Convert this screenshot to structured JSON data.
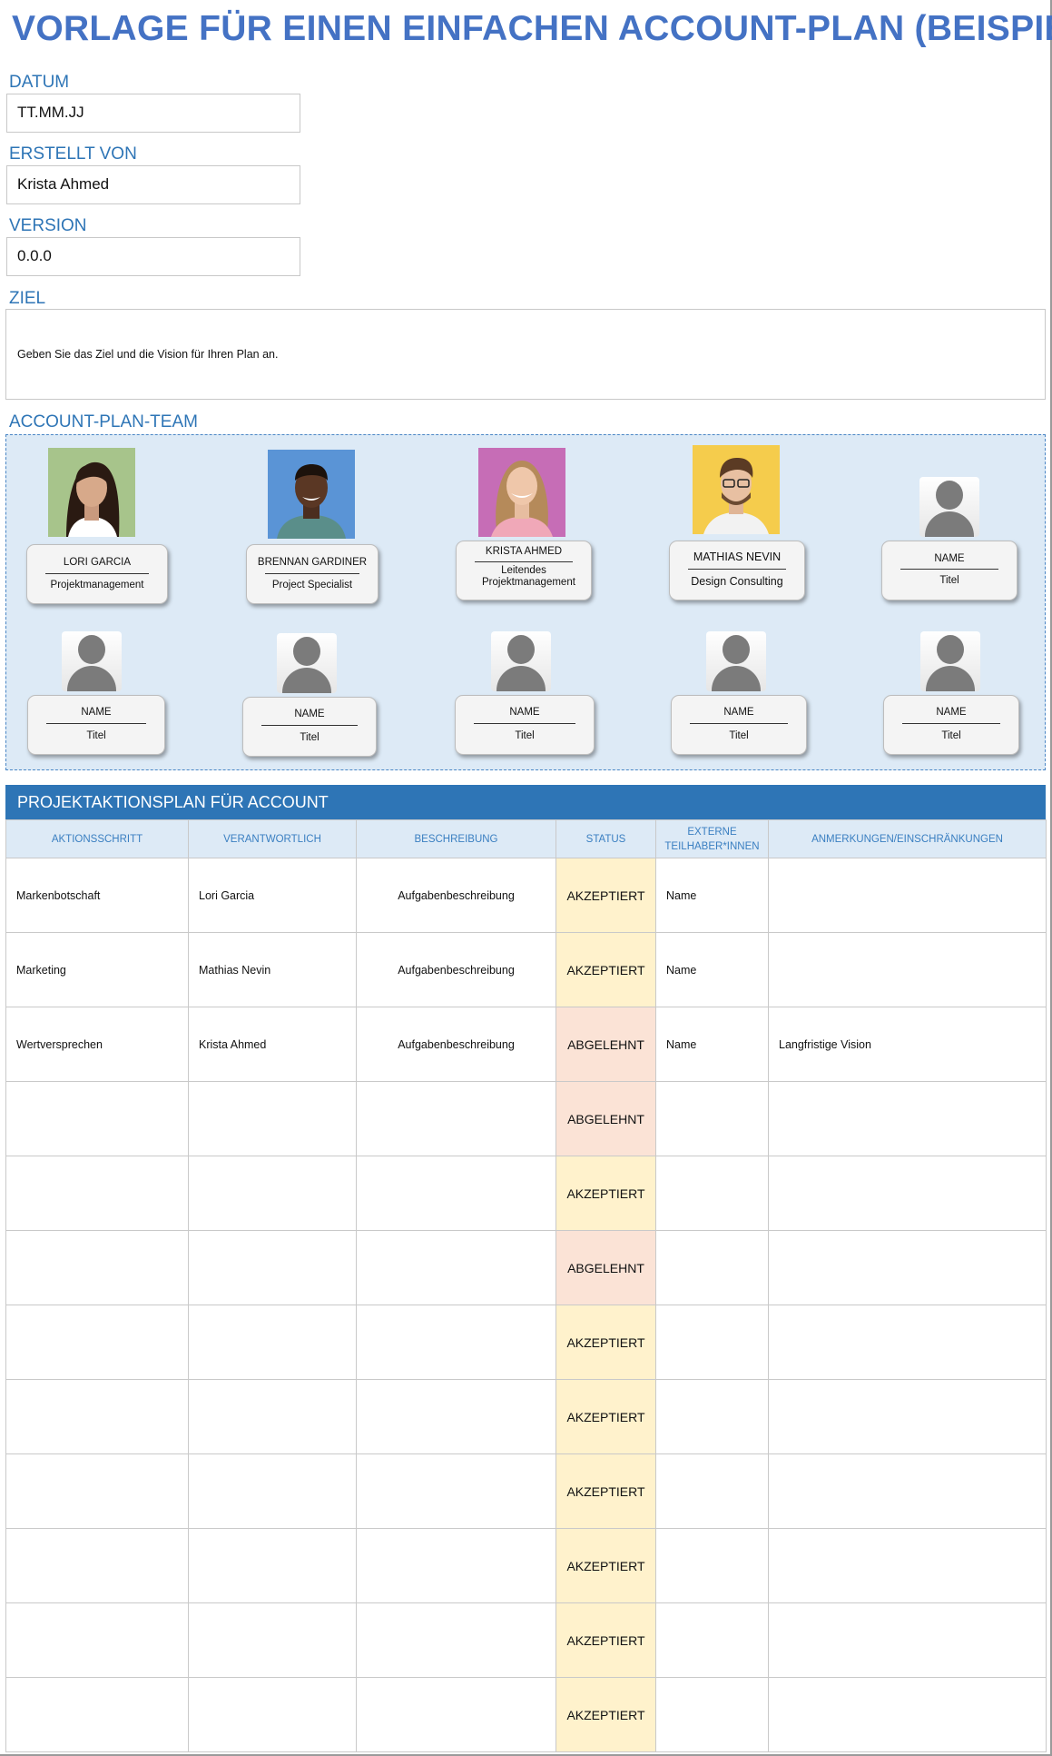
{
  "title": "VORLAGE FÜR EINEN EINFACHEN ACCOUNT-PLAN (BEISPIEL)",
  "fields": {
    "datum_label": "DATUM",
    "datum_value": "TT.MM.JJ",
    "erstellt_label": "ERSTELLT VON",
    "erstellt_value": "Krista Ahmed",
    "version_label": "VERSION",
    "version_value": "0.0.0",
    "ziel_label": "ZIEL",
    "ziel_value": "Geben Sie das Ziel und die Vision für Ihren Plan an."
  },
  "team": {
    "heading": "ACCOUNT-PLAN-TEAM",
    "members": [
      {
        "name": "LORI GARCIA",
        "title": "Projektmanagement"
      },
      {
        "name": "BRENNAN GARDINER",
        "title": "Project Specialist"
      },
      {
        "name": "KRISTA AHMED",
        "title": "Leitendes Projektmanagement"
      },
      {
        "name": "MATHIAS NEVIN",
        "title": "Design Consulting"
      },
      {
        "name": "NAME",
        "title": "Titel"
      },
      {
        "name": "NAME",
        "title": "Titel"
      },
      {
        "name": "NAME",
        "title": "Titel"
      },
      {
        "name": "NAME",
        "title": "Titel"
      },
      {
        "name": "NAME",
        "title": "Titel"
      },
      {
        "name": "NAME",
        "title": "Titel"
      }
    ]
  },
  "plan": {
    "heading": "PROJEKTAKTIONSPLAN FÜR ACCOUNT",
    "columns": [
      "AKTIONSSCHRITT",
      "VERANTWORTLICH",
      "BESCHREIBUNG",
      "STATUS",
      "EXTERNE TEILHABER*INNEN",
      "ANMERKUNGEN/EINSCHRÄNKUNGEN"
    ],
    "rows": [
      [
        "Markenbotschaft",
        "Lori Garcia",
        "Aufgabenbeschreibung",
        "AKZEPTIERT",
        "Name",
        ""
      ],
      [
        "Marketing",
        "Mathias Nevin",
        "Aufgabenbeschreibung",
        "AKZEPTIERT",
        "Name",
        ""
      ],
      [
        "Wertversprechen",
        "Krista Ahmed",
        "Aufgabenbeschreibung",
        "ABGELEHNT",
        "Name",
        "Langfristige Vision"
      ],
      [
        "",
        "",
        "",
        "ABGELEHNT",
        "",
        ""
      ],
      [
        "",
        "",
        "",
        "AKZEPTIERT",
        "",
        ""
      ],
      [
        "",
        "",
        "",
        "ABGELEHNT",
        "",
        ""
      ],
      [
        "",
        "",
        "",
        "AKZEPTIERT",
        "",
        ""
      ],
      [
        "",
        "",
        "",
        "AKZEPTIERT",
        "",
        ""
      ],
      [
        "",
        "",
        "",
        "AKZEPTIERT",
        "",
        ""
      ],
      [
        "",
        "",
        "",
        "AKZEPTIERT",
        "",
        ""
      ],
      [
        "",
        "",
        "",
        "AKZEPTIERT",
        "",
        ""
      ],
      [
        "",
        "",
        "",
        "AKZEPTIERT",
        "",
        ""
      ]
    ]
  },
  "colors": {
    "title": "#4472c4",
    "label": "#2e75b6",
    "team_bg": "#ddeaf6",
    "accepted_bg": "#fff2cc",
    "rejected_bg": "#fbe3d6",
    "header_bar": "#2e75b6"
  }
}
